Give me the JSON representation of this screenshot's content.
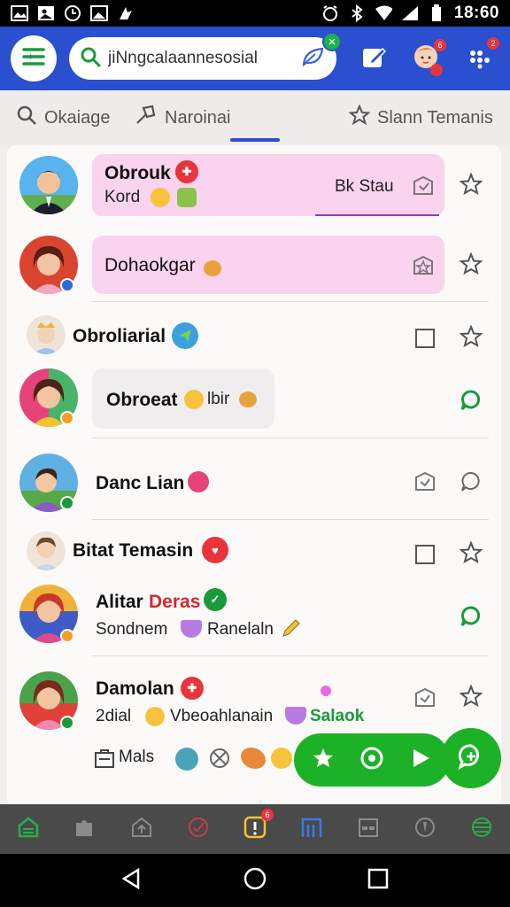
{
  "status_bar": {
    "time": "18:60"
  },
  "app_bar": {
    "search_value": "jiNngcalaannesosial",
    "icons": [
      "menu-icon",
      "search-icon",
      "leaf-icon",
      "compose-icon",
      "avatar-notification-icon",
      "apps-grid-icon"
    ],
    "badge_compose": "",
    "badge_grid": "2"
  },
  "tabs": [
    {
      "label": "Okaiage",
      "icon": "search-icon"
    },
    {
      "label": "Naroinai",
      "icon": "tag-icon"
    },
    {
      "label": "Slann Temanis",
      "icon": "star-icon"
    }
  ],
  "contacts": [
    {
      "name": "Obrouk",
      "sub": "Kord",
      "bubble_right": "Bk Stau"
    },
    {
      "name": "Dohaokgar"
    },
    {
      "name": "Obroliarial"
    },
    {
      "name": "Obroeat",
      "sub_inline": "lbir"
    },
    {
      "name": "Danc Lian"
    },
    {
      "name": "Bitat Temasin"
    },
    {
      "name": "Alitar",
      "name_accent": "Deras",
      "sub_a": "Sondnem",
      "sub_b": "Ranelaln"
    },
    {
      "name": "Damolan",
      "sub_a": "2dial",
      "sub_b": "Vbeoahlanain",
      "sub_accent": "Salaok",
      "extra": "Mals"
    }
  ],
  "colors": {
    "brand": "#2a4fcf",
    "accent_green": "#1db127",
    "bubble_pink": "#fad3ee",
    "alert_red": "#e8343a"
  },
  "bottom_nav_badge": "6"
}
